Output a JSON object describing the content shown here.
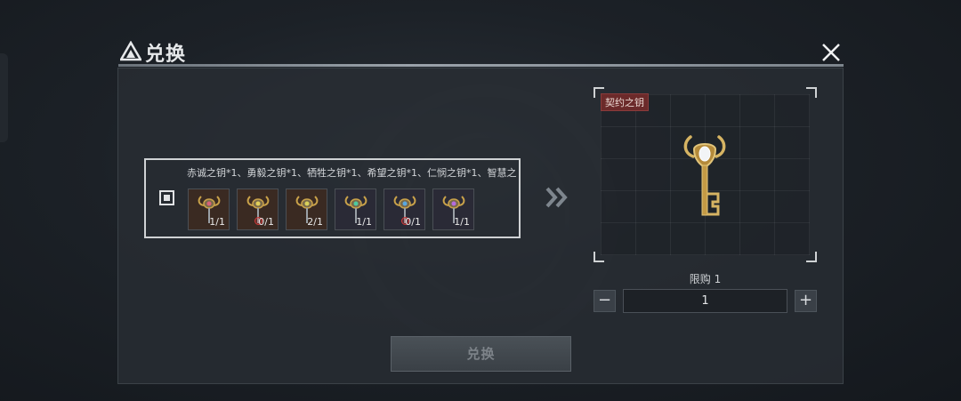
{
  "window": {
    "title": "兑换"
  },
  "cost": {
    "description": "赤诚之钥*1、勇毅之钥*1、牺牲之钥*1、希望之钥*1、仁悯之钥*1、智慧之",
    "items": [
      {
        "name": "赤诚之钥",
        "count": "1/1",
        "gem": "#d9607a",
        "bg": "#3a2a22",
        "flag": false
      },
      {
        "name": "勇毅之钥",
        "count": "0/1",
        "gem": "#e0cf5a",
        "bg": "#3a2a22",
        "flag": true
      },
      {
        "name": "牺牲之钥",
        "count": "2/1",
        "gem": "#d8d05a",
        "bg": "#3a2a22",
        "flag": false
      },
      {
        "name": "希望之钥",
        "count": "1/1",
        "gem": "#4ec9a0",
        "bg": "#2a2a36",
        "flag": false
      },
      {
        "name": "仁悯之钥",
        "count": "0/1",
        "gem": "#5aa8e0",
        "bg": "#2a2a36",
        "flag": true
      },
      {
        "name": "智慧之钥",
        "count": "1/1",
        "gem": "#b46be0",
        "bg": "#2a2a36",
        "flag": false
      }
    ]
  },
  "reward": {
    "name": "契约之钥"
  },
  "purchase": {
    "limit_text": "限购 1",
    "quantity": "1",
    "minus": "−",
    "plus": "+"
  },
  "actions": {
    "exchange_label": "兑换"
  },
  "colors": {
    "gold": "#c9a24a",
    "tag_red": "#6b2a2a"
  }
}
